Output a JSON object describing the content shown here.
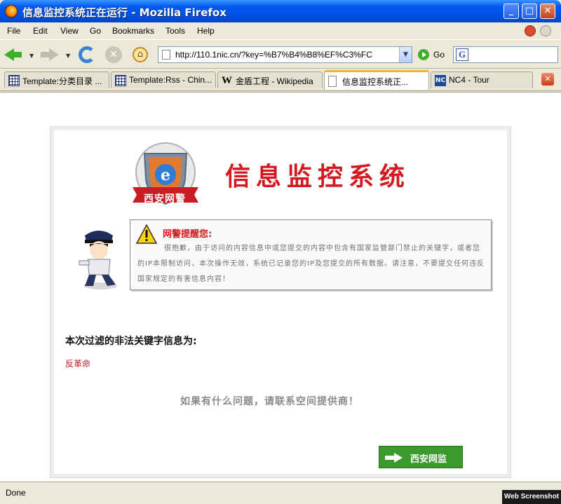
{
  "window": {
    "title": "信息监控系统正在运行 - Mozilla Firefox",
    "minimize": "_",
    "maximize": "□",
    "close": "✕"
  },
  "menu": {
    "file": "File",
    "edit": "Edit",
    "view": "View",
    "go": "Go",
    "bookmarks": "Bookmarks",
    "tools": "Tools",
    "help": "Help"
  },
  "navbar": {
    "url": "http://110.1nic.cn/?key=%B7%B4%B8%EF%C3%FC",
    "go_label": "Go",
    "search_engine_letter": "G"
  },
  "tabs": [
    {
      "label": "Template:分类目录 ...",
      "icon": "grid-icon"
    },
    {
      "label": "Template:Rss - Chin...",
      "icon": "grid-icon"
    },
    {
      "label": "金盾工程 - Wikipedia",
      "icon": "W"
    },
    {
      "label": "信息监控系统正...",
      "icon": "page-icon",
      "active": true
    },
    {
      "label": "NC4 - Tour",
      "icon": "NC"
    }
  ],
  "page": {
    "badge_text": "西安网警",
    "system_title": "信息监控系统",
    "notice_title": "网警提醒您:",
    "notice_body": "很抱歉，由于访问的内容信息中或您提交的内容中包含有国家监管部门禁止的关键字，或者您的IP本限制访问，本次操作无效，系统已记录您的IP及您提交的所有数据。请注意，不要提交任何违反国家规定的有害信息内容！",
    "filter_heading": "本次过滤的非法关键字信息为:",
    "keyword": "反革命",
    "contact_text": "如果有什么问题，请联系空间提供商！",
    "button_label": "西安网监"
  },
  "status": {
    "text": "Done"
  },
  "watermark": "Web Screenshot",
  "colors": {
    "title_red": "#d41920",
    "button_green": "#3a9a2a",
    "xp_blue": "#0058ee"
  }
}
